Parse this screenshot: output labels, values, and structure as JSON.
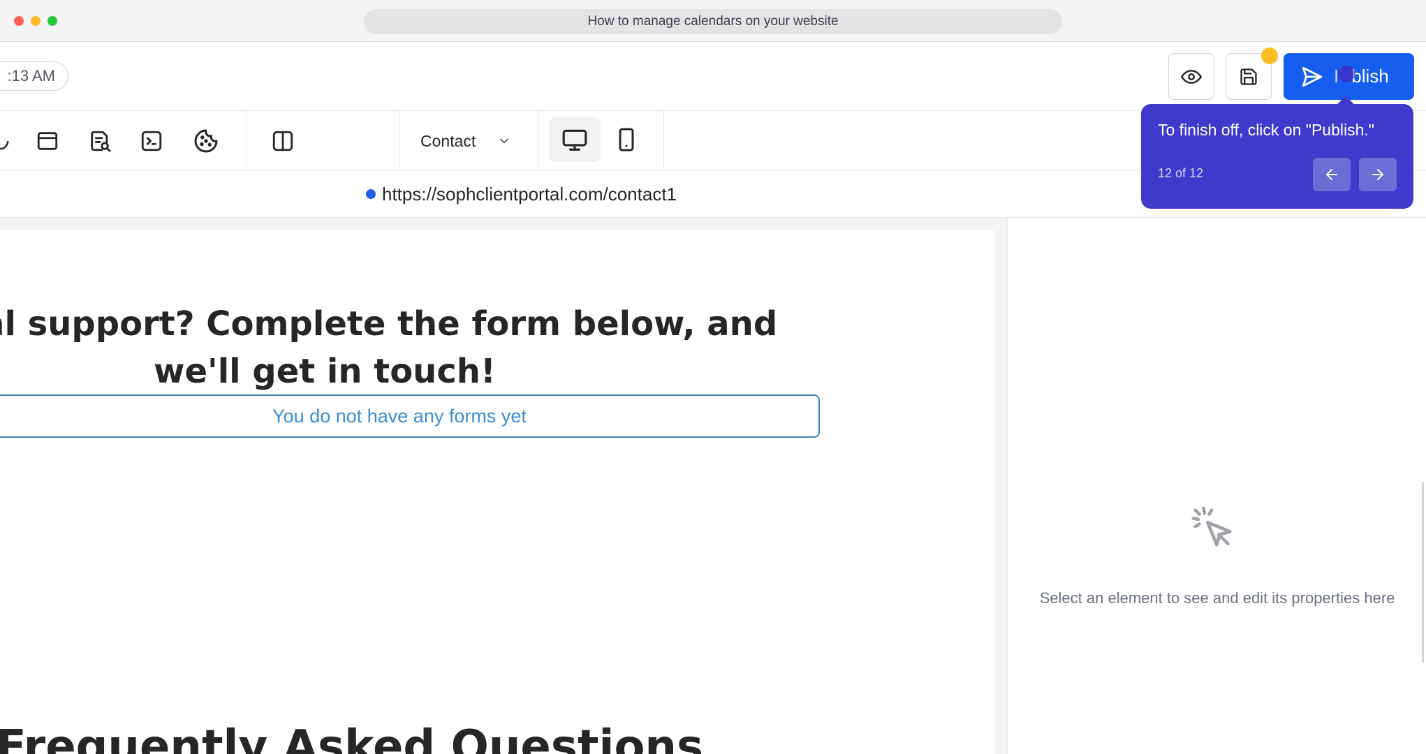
{
  "window": {
    "title": "How to manage calendars on your website"
  },
  "header": {
    "time_text": ":13 AM",
    "publish_label": "blish",
    "publish_label_prefix": "I"
  },
  "toolbar": {
    "page_select": "Contact",
    "icons": [
      "element-icon",
      "section-icon",
      "seo-icon",
      "code-icon",
      "cookie-icon",
      "layout-icon"
    ],
    "devices": [
      "desktop",
      "mobile"
    ]
  },
  "urlrow": {
    "url": "https://sophclientportal.com/contact1"
  },
  "canvas": {
    "headline_line1": "ditional support? Complete the form below, and",
    "headline_line2": "we'll get in touch!",
    "form_empty": "You do not have any forms yet",
    "faq_heading": "Frequently Asked Questions"
  },
  "properties": {
    "hint": "Select an element to see and edit its properties here"
  },
  "tour": {
    "text": "To finish off, click on \"Publish.\"",
    "step": "12 of 12"
  },
  "colors": {
    "accent": "#155eef",
    "tour_bg": "#4139cc",
    "unsaved": "#fbbf24",
    "link": "#3b8ed0"
  }
}
